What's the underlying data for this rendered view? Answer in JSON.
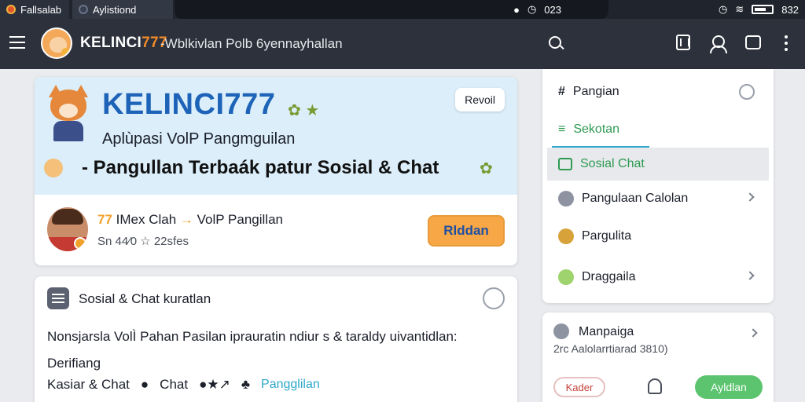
{
  "status": {
    "tab1": "Fallsalab",
    "tab2": "Aylistiond",
    "clock": "023",
    "battery": "832"
  },
  "appbar": {
    "brand": "KELINCI",
    "brand_num": "777",
    "subtitle": "-Wblkivlan Polb 6yennayhallan"
  },
  "hero": {
    "title": "KELINCI777",
    "chip": "Revoil",
    "tagline": "Aplùpasi VolP Pangmguilan",
    "headline": "- Pangullan Terbaák patur Sosial & Chat",
    "line1_accent": "77",
    "line1_name": "IMex Clah",
    "line1_rest": "VolP Pangillan",
    "line2": "Sn 44⁄0 ☆ 22sfes",
    "cta": "Rlddan"
  },
  "social": {
    "header": "Sosial & Chat  kuratlan",
    "body1": "Nonsjarsla VolÌ Pahan Pasilan  iprauratin  ndiur s & taraldy uivantidlan:",
    "body2": "Derifiang",
    "footer_a": "Kasiar & Chat",
    "footer_b": "Chat",
    "footer_link": "Pangglilan"
  },
  "nav": {
    "items": [
      {
        "label": "Pangian"
      },
      {
        "label": "Sekotan"
      },
      {
        "label": "Sosial Chat"
      },
      {
        "label": "Pangulaan Calolan"
      },
      {
        "label": "Pargulita"
      },
      {
        "label": "Draggaila"
      }
    ]
  },
  "mini": {
    "title": "Manpaiga",
    "subtitle": "2rc Aalolarrtiarad 3810)",
    "btn1": "Kader",
    "btn2": "Ayldlan"
  }
}
